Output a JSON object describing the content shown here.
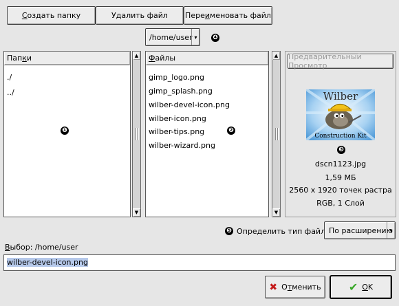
{
  "toolbar": {
    "create_folder_pre": "",
    "create_folder_u": "С",
    "create_folder_post": "оздать папку",
    "delete_file_pre": "У",
    "delete_file_u": "д",
    "delete_file_post": "алить файл",
    "rename_file_pre": "Пере",
    "rename_file_u": "и",
    "rename_file_post": "меновать файл"
  },
  "path_dropdown": {
    "value": "/home/user",
    "arrow": "▾"
  },
  "folders": {
    "header_pre": "Пап",
    "header_u": "к",
    "header_post": "и",
    "items": [
      "./",
      "../"
    ]
  },
  "files": {
    "header_pre": "",
    "header_u": "Ф",
    "header_post": "айлы",
    "items": [
      "gimp_logo.png",
      "gimp_splash.png",
      "wilber-devel-icon.png",
      "wilber-icon.png",
      "wilber-tips.png",
      "wilber-wizard.png"
    ]
  },
  "preview": {
    "button_label": "Предварительный Просмотр",
    "thumb_title": "Wilber",
    "thumb_caption": "Construction Kit",
    "filename": "dscn1123.jpg",
    "filesize": "1,59 МБ",
    "dimensions": "2560 x 1920 точек растра",
    "mode": "RGB, 1 Слой"
  },
  "markers": [
    "❶",
    "❷",
    "❸",
    "❹",
    "❺"
  ],
  "filetype": {
    "label": "Определить тип файла:",
    "value": "По расширению",
    "arrow": "▾"
  },
  "selection": {
    "label_u": "В",
    "label_post": "ыбор: /home/user",
    "value": "wilber-devel-icon.png"
  },
  "actions": {
    "cancel_pre": "О",
    "cancel_u": "т",
    "cancel_post": "менить",
    "ok_u": "O",
    "ok_post": "K",
    "cancel_icon": "✖",
    "ok_icon": "✔"
  },
  "colors": {
    "selection_bg": "#b6c9ea",
    "cancel_icon": "#c41a1a",
    "ok_icon": "#3aa82a",
    "thumb_sky": "#7fb8e8"
  }
}
